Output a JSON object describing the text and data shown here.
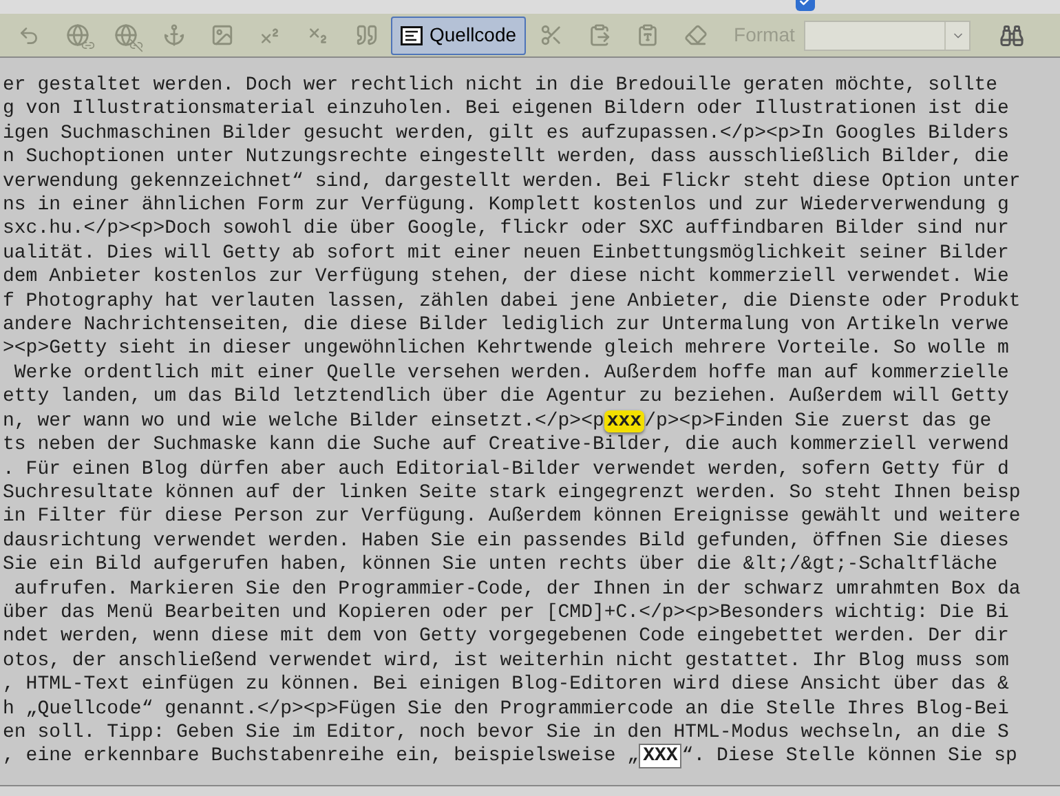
{
  "options": {
    "checked": true
  },
  "toolbar": {
    "source_button": {
      "label": "Quellcode",
      "selected": true
    },
    "format": {
      "label": "Format",
      "disabled": true
    }
  },
  "editor": {
    "lines": [
      {
        "text": "er gestaltet werden. Doch wer rechtlich nicht in die Bredouille geraten möchte, sollte"
      },
      {
        "text": "g von Illustrationsmaterial einzuholen. Bei eigenen Bildern oder Illustrationen ist die"
      },
      {
        "text": "igen Suchmaschinen Bilder gesucht werden, gilt es aufzupassen.</p><p>In Googles Bilders"
      },
      {
        "text": "n Suchoptionen unter Nutzungsrechte eingestellt werden, dass ausschließlich Bilder, die"
      },
      {
        "text": "verwendung gekennzeichnet“ sind, dargestellt werden. Bei Flickr steht diese Option unter"
      },
      {
        "text": "ns in einer ähnlichen Form zur Verfügung. Komplett kostenlos und zur Wiederverwendung g"
      },
      {
        "text": "sxc.hu.</p><p>Doch sowohl die über Google, flickr oder SXC auffindbaren Bilder sind nur"
      },
      {
        "text": "ualität. Dies will Getty ab sofort mit einer neuen Einbettungsmöglichkeit seiner Bilder"
      },
      {
        "text": "dem Anbieter kostenlos zur Verfügung stehen, der diese nicht kommerziell verwendet. Wie"
      },
      {
        "text": "f Photography hat verlauten lassen, zählen dabei jene Anbieter, die Dienste oder Produkt"
      },
      {
        "text": "andere Nachrichtenseiten, die diese Bilder lediglich zur Untermalung von Artikeln verwe"
      },
      {
        "text": "><p>Getty sieht in dieser ungewöhnlichen Kehrtwende gleich mehrere Vorteile. So wolle m"
      },
      {
        "text": " Werke ordentlich mit einer Quelle versehen werden. Außerdem hoffe man auf kommerzielle"
      },
      {
        "text": "etty landen, um das Bild letztendlich über die Agentur zu beziehen. Außerdem will Getty"
      },
      {
        "segments": [
          {
            "kind": "plain",
            "text": "n, wer wann wo und wie welche Bilder einsetzt.</p><p"
          },
          {
            "kind": "highlight",
            "text": "xxx"
          },
          {
            "kind": "plain",
            "text": "/p><p>Finden Sie zuerst das ge"
          }
        ]
      },
      {
        "text": "ts neben der Suchmaske kann die Suche auf Creative-Bilder, die auch kommerziell verwend"
      },
      {
        "text": ". Für einen Blog dürfen aber auch Editorial-Bilder verwendet werden, sofern Getty für d"
      },
      {
        "text": "Suchresultate können auf der linken Seite stark eingegrenzt werden. So steht Ihnen beisp"
      },
      {
        "text": "in Filter für diese Person zur Verfügung. Außerdem können Ereignisse gewählt und weitere"
      },
      {
        "text": "dausrichtung verwendet werden. Haben Sie ein passendes Bild gefunden, öffnen Sie dieses"
      },
      {
        "text": "Sie ein Bild aufgerufen haben, können Sie unten rechts über die &lt;/&gt;-Schaltfläche"
      },
      {
        "text": " aufrufen. Markieren Sie den Programmier-Code, der Ihnen in der schwarz umrahmten Box da"
      },
      {
        "text": "über das Menü Bearbeiten und Kopieren oder per [CMD]+C.</p><p>Besonders wichtig: Die Bi"
      },
      {
        "text": "ndet werden, wenn diese mit dem von Getty vorgegebenen Code eingebettet werden. Der dir"
      },
      {
        "text": "otos, der anschließend verwendet wird, ist weiterhin nicht gestattet. Ihr Blog muss som"
      },
      {
        "text": ", HTML-Text einfügen zu können. Bei einigen Blog-Editoren wird diese Ansicht über das &"
      },
      {
        "text": "h „Quellcode“ genannt.</p><p>Fügen Sie den Programmiercode an die Stelle Ihres Blog-Bei"
      },
      {
        "text": "en soll. Tipp: Geben Sie im Editor, noch bevor Sie in den HTML-Modus wechseln, an die S"
      },
      {
        "segments": [
          {
            "kind": "plain",
            "text": ", eine erkennbare Buchstabenreihe ein, beispielsweise „"
          },
          {
            "kind": "boxed",
            "text": "XXX"
          },
          {
            "kind": "plain",
            "text": "“. Diese Stelle können Sie sp"
          }
        ]
      }
    ]
  }
}
